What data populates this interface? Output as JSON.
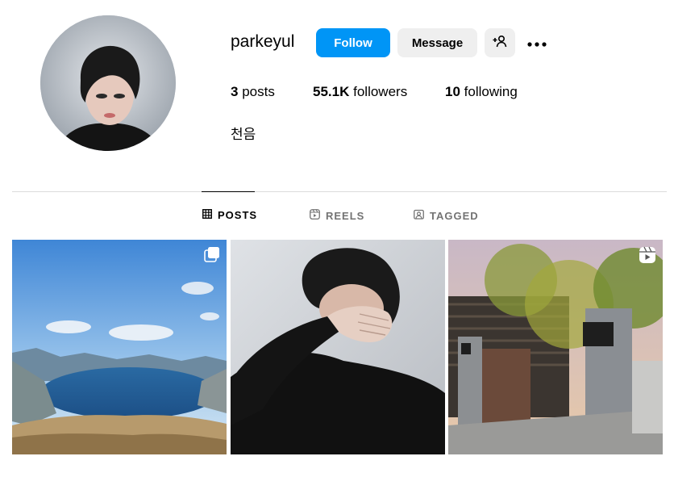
{
  "profile": {
    "username": "parkeyul",
    "follow_label": "Follow",
    "message_label": "Message",
    "posts_count": "3",
    "posts_label": "posts",
    "followers_count": "55.1K",
    "followers_label": "followers",
    "following_count": "10",
    "following_label": "following",
    "bio": "천음"
  },
  "tabs": [
    {
      "label": "POSTS",
      "icon": "grid-icon",
      "active": true
    },
    {
      "label": "REELS",
      "icon": "reels-icon",
      "active": false
    },
    {
      "label": "TAGGED",
      "icon": "tagged-icon",
      "active": false
    }
  ],
  "posts": [
    {
      "type": "carousel",
      "badge_icon": "carousel-icon",
      "subject": "mountain lake landscape"
    },
    {
      "type": "photo",
      "subject": "selfie hand covering face"
    },
    {
      "type": "reel",
      "badge_icon": "reel-icon",
      "subject": "building entrance with trees"
    }
  ],
  "colors": {
    "follow_button": "#0095f6",
    "secondary_button": "#efefef",
    "divider": "#dbdbdb",
    "inactive_tab": "#737373"
  }
}
